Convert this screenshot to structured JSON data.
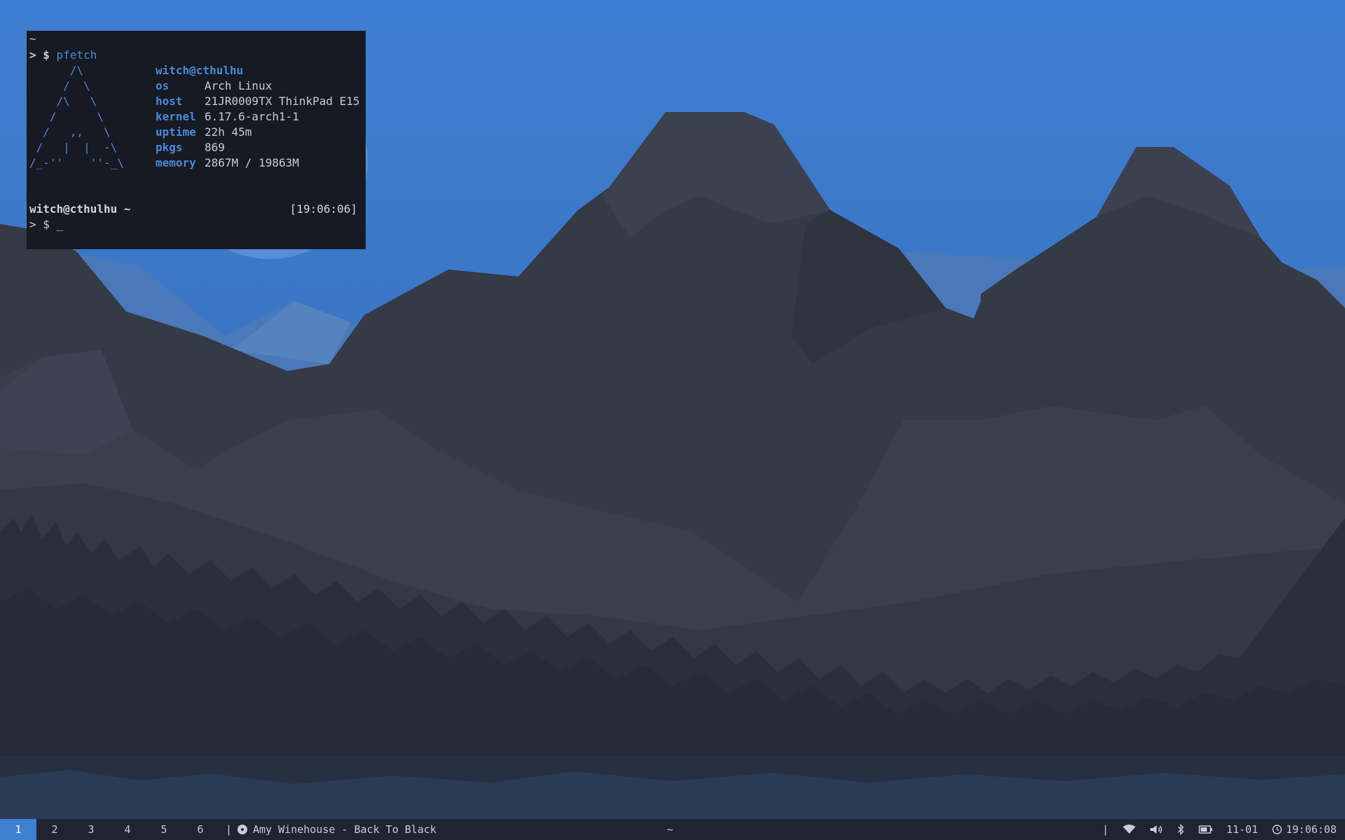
{
  "terminal": {
    "title": "~",
    "command_prompt": "> $",
    "command": "pfetch",
    "ascii_art": "      /\\\n     /  \\\n    /\\   \\\n   /      \\\n  /   ,,   \\\n /   |  |  -\\\n/_-''    ''-_\\",
    "user_host": "witch@cthulhu",
    "info": [
      {
        "key": "os",
        "value": "Arch Linux"
      },
      {
        "key": "host",
        "value": "21JR0009TX ThinkPad E15"
      },
      {
        "key": "kernel",
        "value": "6.17.6-arch1-1"
      },
      {
        "key": "uptime",
        "value": "22h 45m"
      },
      {
        "key": "pkgs",
        "value": "869"
      },
      {
        "key": "memory",
        "value": "2867M / 19863M"
      }
    ],
    "prompt_left": "witch@cthulhu ~",
    "prompt_time": "[19:06:06]",
    "prompt_input": "> $ _"
  },
  "taskbar": {
    "workspaces": [
      "1",
      "2",
      "3",
      "4",
      "5",
      "6"
    ],
    "active_workspace": "1",
    "separator": "|",
    "now_playing": "Amy Winehouse - Back To Black",
    "window_title": "~",
    "tray": {
      "wifi_icon": "wifi-icon",
      "volume_icon": "volume-icon",
      "bluetooth_icon": "bluetooth-icon",
      "battery_icon": "battery-icon",
      "date": "11-01",
      "clock_icon": "clock-icon",
      "time": "19:06:08"
    }
  },
  "colors": {
    "accent": "#3f7fd0",
    "terminal_bg": "#171a22",
    "taskbar_bg": "#1f2430"
  }
}
